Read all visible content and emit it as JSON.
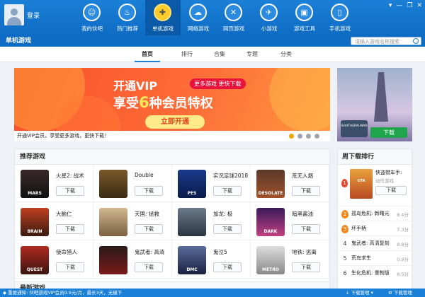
{
  "header": {
    "login_label": "登录",
    "nav": [
      {
        "label": "我的伙吧",
        "icon": "user-icon",
        "glyph": "☺"
      },
      {
        "label": "热门推荐",
        "icon": "fire-icon",
        "glyph": "♨"
      },
      {
        "label": "单机游戏",
        "icon": "gamepad-icon",
        "glyph": "✚"
      },
      {
        "label": "网络游戏",
        "icon": "cloud-icon",
        "glyph": "☁"
      },
      {
        "label": "网页游戏",
        "icon": "tools-icon",
        "glyph": "✕"
      },
      {
        "label": "小游戏",
        "icon": "plane-icon",
        "glyph": "✈"
      },
      {
        "label": "游戏工具",
        "icon": "toolbox-icon",
        "glyph": "▣"
      },
      {
        "label": "手机游戏",
        "icon": "phone-icon",
        "glyph": "▯"
      }
    ],
    "window_controls": [
      "▾",
      "—",
      "❐",
      "✕"
    ]
  },
  "subbar": {
    "title": "单机游戏",
    "search_placeholder": "请输入游戏名称搜索"
  },
  "tabs": [
    "首页",
    "排行",
    "合集",
    "专题",
    "分类"
  ],
  "active_tab": "首页",
  "banner": {
    "vip_label": "开通VIP",
    "tag": "更多游戏 更快下载",
    "headline_pre": "享受",
    "headline_num": "6",
    "headline_post": "种会员特权",
    "cta": "立即开通",
    "caption": "开通VIP会员，享受更多游戏，更快下载！"
  },
  "featured": {
    "logo_text": "SOUTHERN WAR",
    "download": "下载"
  },
  "recommended": {
    "title": "推荐游戏",
    "download_label": "下载",
    "games": [
      {
        "name": "火星2: 战术",
        "thumb_text": "MARS"
      },
      {
        "name": "Double",
        "thumb_text": ""
      },
      {
        "name": "实况足球2018",
        "thumb_text": "PES"
      },
      {
        "name": "荒无人烟",
        "thumb_text": "DESOLATE"
      },
      {
        "name": "大脑仁",
        "thumb_text": "BRAIN"
      },
      {
        "name": "天国: 拯救",
        "thumb_text": ""
      },
      {
        "name": "加龙: 极",
        "thumb_text": ""
      },
      {
        "name": "暗黑酱油",
        "thumb_text": "DARK"
      },
      {
        "name": "使命猎人",
        "thumb_text": "QUEST"
      },
      {
        "name": "鬼武者: 高清",
        "thumb_text": ""
      },
      {
        "name": "鬼泣5",
        "thumb_text": "DMC"
      },
      {
        "name": "地铁: 逃离",
        "thumb_text": "METRO"
      }
    ]
  },
  "latest_title": "最新游戏",
  "ranking": {
    "title": "周下载排行",
    "top": {
      "rank": "1",
      "name": "侠盗猎车手:",
      "sub": "动作游戏",
      "thumb_text": "GTA",
      "download": "下载"
    },
    "rows": [
      {
        "rank": "2",
        "name": "孤岛危机: 新曙光",
        "score": "8.4分"
      },
      {
        "rank": "3",
        "name": "坏手柄",
        "score": "7.3分"
      },
      {
        "rank": "4",
        "name": "鬼武者: 高清复刻",
        "score": "8.8分"
      },
      {
        "rank": "5",
        "name": "荒岛求生",
        "score": "0.9分"
      },
      {
        "rank": "6",
        "name": "生化危机: 重制版",
        "score": "8.5分"
      }
    ]
  },
  "status": {
    "notice": "◆ 重要通知: 伙吧游戏VIP会员9.9元/月，最长3天，无缝下",
    "download_mgr": "↓ 下载管理 ▾",
    "settings": "⚙ 下载管理"
  }
}
